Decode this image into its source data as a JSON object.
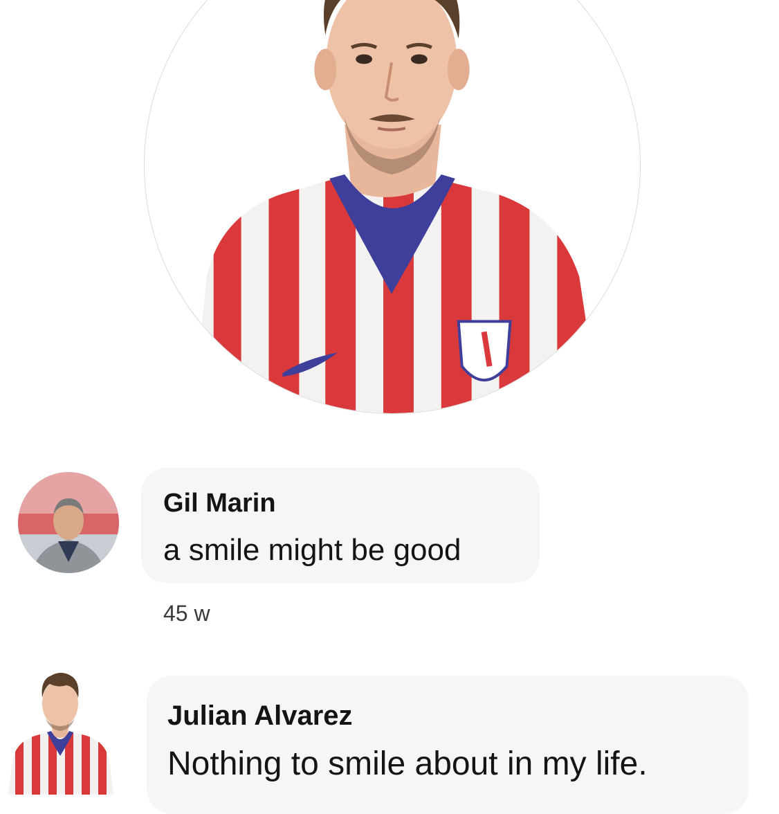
{
  "profile": {
    "photo_icon": "profile-photo-player-jersey"
  },
  "comments": [
    {
      "author": "Gil Marin",
      "text": "a smile might be good",
      "time": "45 w",
      "avatar_icon": "avatar-man-grey-jacket"
    },
    {
      "author": "Julian Alvarez",
      "text": "Nothing to smile about in my life.",
      "avatar_icon": "avatar-player-jersey"
    }
  ],
  "colors": {
    "jersey_red": "#d9393b",
    "jersey_white": "#f4f2f0",
    "collar_blue": "#3e3f9a",
    "bubble_bg": "#f5f6f8"
  }
}
